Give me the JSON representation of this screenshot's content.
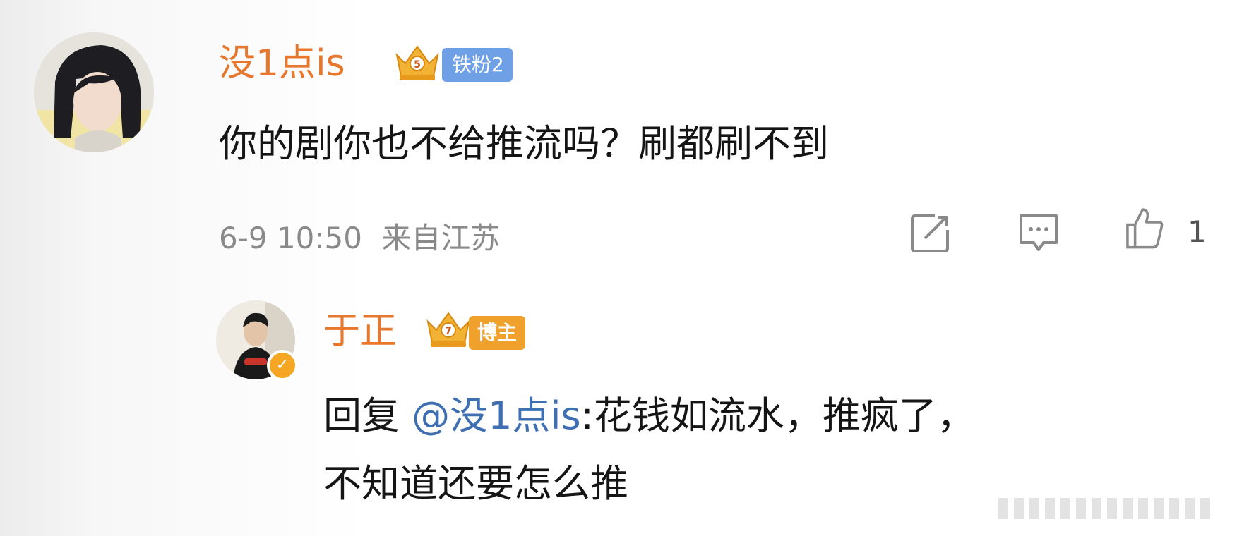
{
  "comment": {
    "username": "没1点is",
    "fan_badge": "铁粉2",
    "crown_level": "5",
    "text": "你的剧你也不给推流吗？刷都刷不到",
    "timestamp": "6-9 10:50",
    "location": "来自江苏",
    "like_count": "1"
  },
  "reply": {
    "username": "于正",
    "blogger_badge": "博主",
    "crown_level": "7",
    "reply_prefix": "回复",
    "mention": "@没1点is",
    "text_line1": ":花钱如流水，推疯了，",
    "text_line2": "不知道还要怎么推"
  },
  "icons": {
    "share": "share-icon",
    "comment": "comment-icon",
    "like": "thumbs-up-icon",
    "verified": "verified-badge-icon",
    "crown": "crown-icon"
  },
  "colors": {
    "username": "#e8772e",
    "mention": "#3f6fb3",
    "fan_badge": "#6fa0e6",
    "blogger_badge": "#f0a12c",
    "meta_text": "#8a8a8a"
  }
}
